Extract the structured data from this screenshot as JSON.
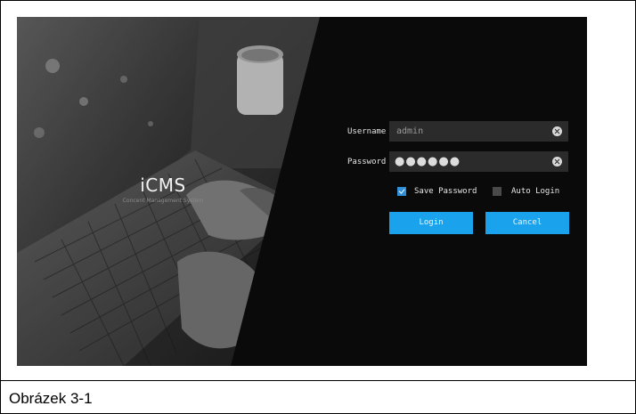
{
  "branding": {
    "logo": "iCMS",
    "tagline": "Concent Management System"
  },
  "login_form": {
    "username_label": "Username",
    "username_value": "admin",
    "password_label": "Password",
    "password_value": "●●●●●●",
    "save_password_label": "Save Password",
    "save_password_checked": true,
    "auto_login_label": "Auto Login",
    "auto_login_checked": false,
    "login_button": "Login",
    "cancel_button": "Cancel"
  },
  "figure": {
    "caption": "Obrázek 3-1"
  },
  "colors": {
    "accent": "#1aa3ec",
    "background": "#0a0a0a",
    "field": "#2b2b2b"
  }
}
